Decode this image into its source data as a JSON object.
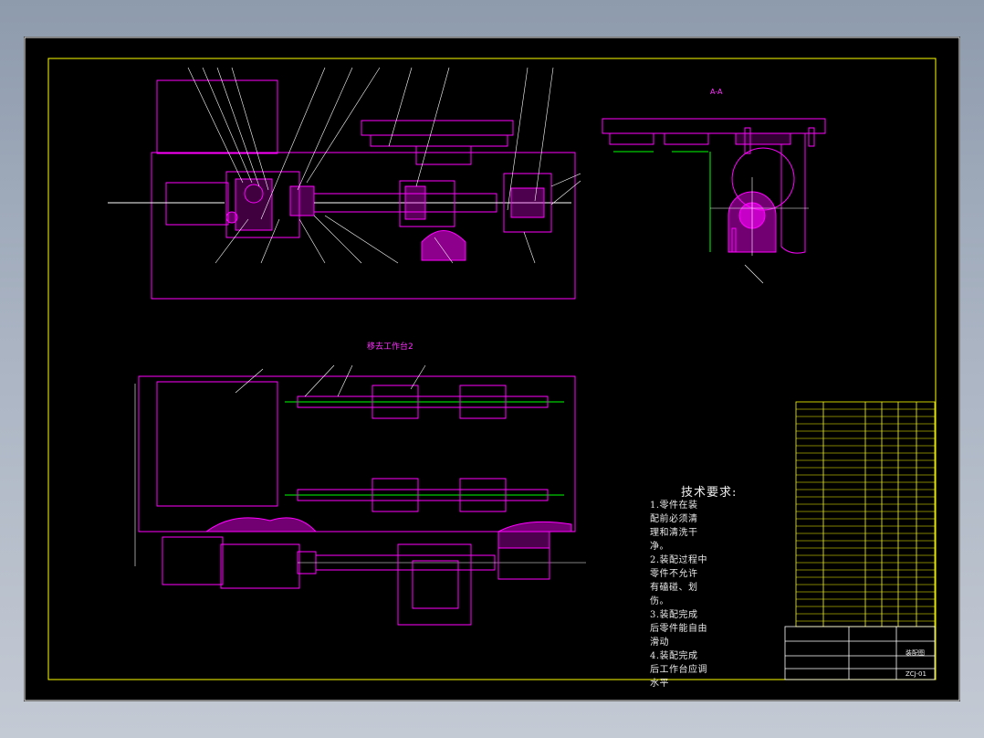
{
  "drawing": {
    "section_label": "A-A",
    "view_title": "移去工作台2",
    "code": "ZCJ-01",
    "title_block_name": "装配图"
  },
  "technical_requirements": {
    "title": "技术要求:",
    "lines": [
      "1.零件在装",
      "配前必须清",
      "理和清洗干",
      "净。",
      "2.装配过程中",
      "零件不允许",
      "有磕碰、划",
      "伤。",
      "3.装配完成",
      "后零件能自由",
      "滑动",
      "4.装配完成",
      "后工作台应调",
      "水平"
    ]
  },
  "colors": {
    "background": "#000000",
    "frame": "#ffff00",
    "outline": "#ff00ff",
    "centerline": "#00ff00",
    "text": "#ffffff"
  }
}
